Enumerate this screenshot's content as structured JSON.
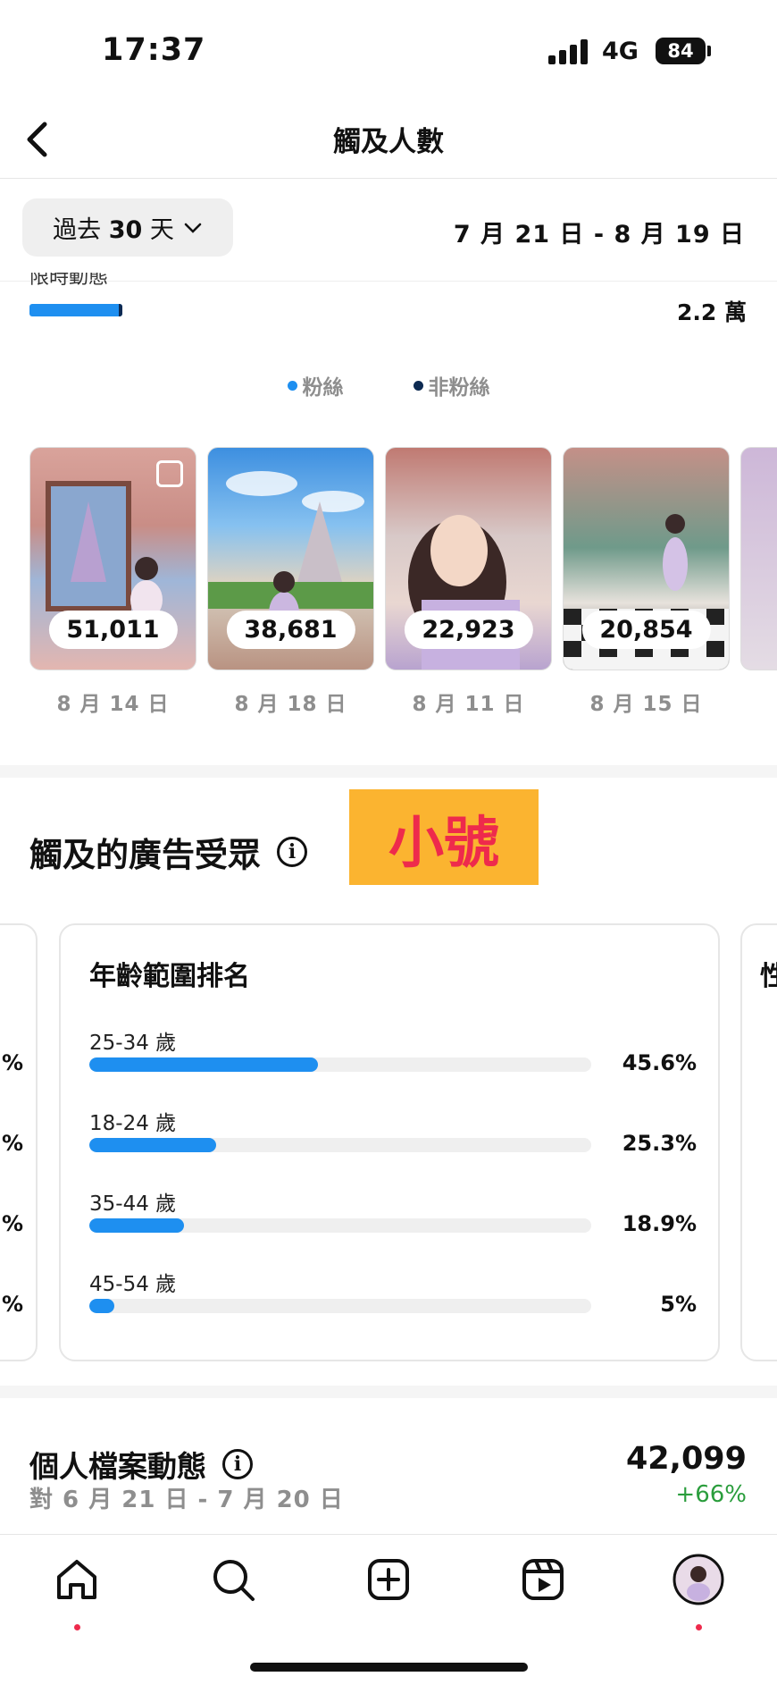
{
  "status": {
    "time": "17:37",
    "network": "4G",
    "battery": "84"
  },
  "header": {
    "title": "觸及人數"
  },
  "filter": {
    "range_prefix": "過去 ",
    "range_days": "30",
    "range_suffix": " 天",
    "date_range": "7 月 21 日 - 8 月 19 日"
  },
  "stories": {
    "label": "限時動態",
    "value": "2.2 萬"
  },
  "legend": {
    "followers": "粉絲",
    "non_followers": "非粉絲",
    "followers_color": "#1e8ff0",
    "non_followers_color": "#0d2a52"
  },
  "posts": [
    {
      "count": "51,011",
      "date": "8 月 14 日"
    },
    {
      "count": "38,681",
      "date": "8 月 18 日"
    },
    {
      "count": "22,923",
      "date": "8 月 11 日"
    },
    {
      "count": "20,854",
      "date": "8 月 15 日"
    }
  ],
  "audience": {
    "title": "觸及的廣告受眾",
    "sticker": "小號",
    "age_card_title": "年齡範圍排名",
    "ages": [
      {
        "label": "25-34 歲",
        "percent": "45.6%",
        "value": 45.6
      },
      {
        "label": "18-24 歲",
        "percent": "25.3%",
        "value": 25.3
      },
      {
        "label": "35-44 歲",
        "percent": "18.9%",
        "value": 18.9
      },
      {
        "label": "45-54 歲",
        "percent": "5%",
        "value": 5
      }
    ],
    "left_card_partial": [
      "%",
      "%",
      "%",
      "%"
    ],
    "right_card_partial": "性"
  },
  "activity": {
    "title": "個人檔案動態",
    "compare": "對 6 月 21 日 - 7 月 20 日",
    "value": "42,099",
    "change": "+66%"
  },
  "tabbar": [
    "home-icon",
    "search-icon",
    "create-icon",
    "reels-icon",
    "profile-avatar"
  ]
}
